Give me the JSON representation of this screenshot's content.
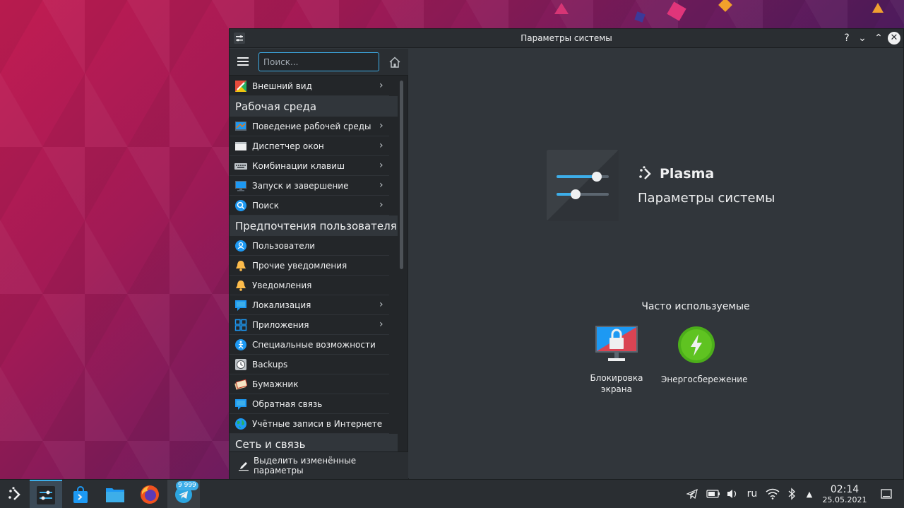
{
  "window": {
    "title": "Параметры системы",
    "controls": {
      "help": "?",
      "minimize": "⌄",
      "maximize": "⌃",
      "close": "✕"
    }
  },
  "sidebar": {
    "search_placeholder": "Поиск...",
    "items": [
      {
        "label": "Внешний вид",
        "icon": "appearance-icon",
        "has_children": true
      },
      {
        "section": "Рабочая среда"
      },
      {
        "label": "Поведение рабочей среды",
        "icon": "workspace-behavior-icon",
        "has_children": true
      },
      {
        "label": "Диспетчер окон",
        "icon": "window-manager-icon",
        "has_children": true
      },
      {
        "label": "Комбинации клавиш",
        "icon": "keyboard-icon",
        "has_children": true
      },
      {
        "label": "Запуск и завершение",
        "icon": "startup-icon",
        "has_children": true
      },
      {
        "label": "Поиск",
        "icon": "search-icon",
        "has_children": true
      },
      {
        "section": "Предпочтения пользователя"
      },
      {
        "label": "Пользователи",
        "icon": "users-icon",
        "has_children": false
      },
      {
        "label": "Прочие уведомления",
        "icon": "bell-icon",
        "has_children": false
      },
      {
        "label": "Уведомления",
        "icon": "bell-icon",
        "has_children": false
      },
      {
        "label": "Локализация",
        "icon": "localization-icon",
        "has_children": true
      },
      {
        "label": "Приложения",
        "icon": "applications-icon",
        "has_children": true
      },
      {
        "label": "Специальные возможности",
        "icon": "accessibility-icon",
        "has_children": false
      },
      {
        "label": "Backups",
        "icon": "backups-icon",
        "has_children": false
      },
      {
        "label": "Бумажник",
        "icon": "wallet-icon",
        "has_children": false
      },
      {
        "label": "Обратная связь",
        "icon": "feedback-icon",
        "has_children": false
      },
      {
        "label": "Учётные записи в Интернете",
        "icon": "globe-icon",
        "has_children": false
      },
      {
        "section": "Сеть и связь"
      }
    ],
    "footer_label": "Выделить изменённые параметры"
  },
  "main": {
    "brand": "Plasma",
    "subtitle": "Параметры системы",
    "frequent_title": "Часто используемые",
    "frequent": [
      {
        "label": "Блокировка экрана",
        "icon": "screen-lock-icon"
      },
      {
        "label": "Энергосбережение",
        "icon": "power-icon"
      }
    ]
  },
  "taskbar": {
    "telegram_badge": "9 999",
    "tray_language": "ru",
    "clock_time": "02:14",
    "clock_date": "25.05.2021"
  },
  "colors": {
    "accent": "#3daee9",
    "window_bg": "#31363b",
    "sidebar_bg": "#232629",
    "text": "#eff0f1"
  }
}
